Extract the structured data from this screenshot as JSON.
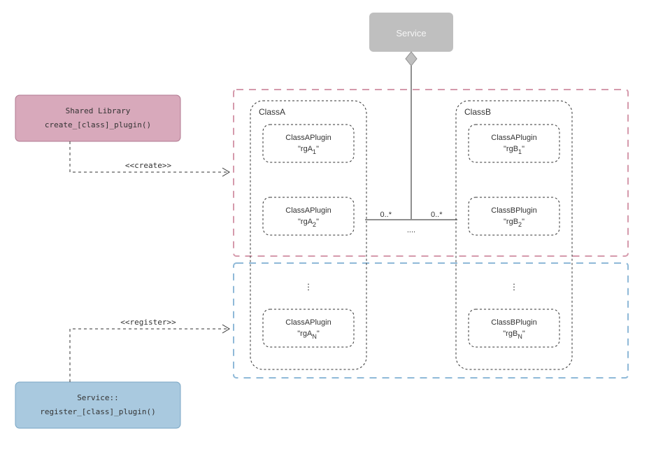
{
  "service": {
    "label": "Service"
  },
  "sharedLib": {
    "title": "Shared Library",
    "fn": "create_[class]_plugin()"
  },
  "registrar": {
    "title": "Service::",
    "fn": "register_[class]_plugin()"
  },
  "arrows": {
    "create": "<<create>>",
    "register": "<<register>>"
  },
  "classA": {
    "title": "ClassA",
    "plugins": [
      {
        "name": "ClassAPlugin",
        "ref": "\"rgA",
        "sub": "1",
        "refEnd": "\""
      },
      {
        "name": "ClassAPlugin",
        "ref": "\"rgA",
        "sub": "2",
        "refEnd": "\""
      },
      {
        "name": "ClassAPlugin",
        "ref": "\"rgA",
        "sub": "N",
        "refEnd": "\""
      }
    ]
  },
  "classB": {
    "title": "ClassB",
    "plugins": [
      {
        "name": "ClassAPlugin",
        "ref": "\"rgB",
        "sub": "1",
        "refEnd": "\""
      },
      {
        "name": "ClassBPlugin",
        "ref": "\"rgB",
        "sub": "2",
        "refEnd": "\""
      },
      {
        "name": "ClassBPlugin",
        "ref": "\"rgB",
        "sub": "N",
        "refEnd": "\""
      }
    ]
  },
  "mult": {
    "left": "0..*",
    "right": "0..*",
    "ell": "...."
  },
  "vdots": "⋮"
}
